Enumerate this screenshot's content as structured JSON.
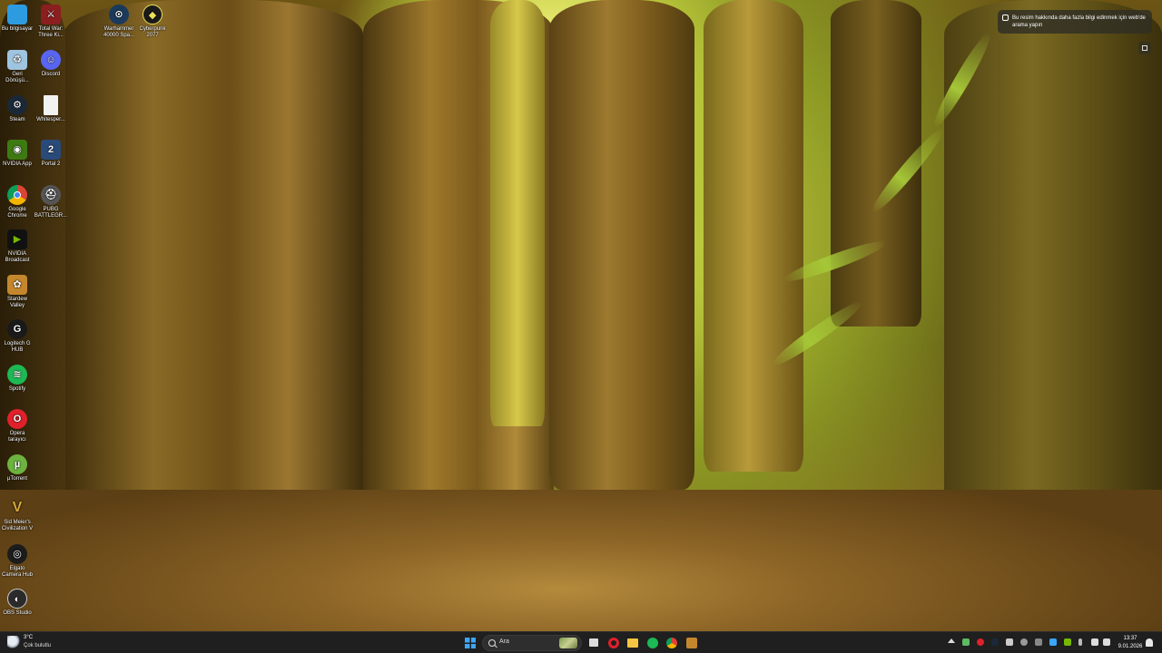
{
  "desktop": {
    "icons_col1": [
      {
        "name": "this-pc-icon",
        "label": "Bu bilgisayar",
        "color": "#2d9be0"
      },
      {
        "name": "recycle-bin-icon",
        "label": "Geri\nDönüşü...",
        "color": "#9fc4e0"
      },
      {
        "name": "steam-icon",
        "label": "Steam",
        "color": "#1b2838"
      },
      {
        "name": "nvidia-app-icon",
        "label": "NVIDIA App",
        "color": "#3d7a12"
      },
      {
        "name": "google-chrome-icon",
        "label": "Google\nChrome",
        "color": "#db4437"
      },
      {
        "name": "nvidia-broadcast-icon",
        "label": "NVIDIA\nBroadcast",
        "color": "#111111"
      },
      {
        "name": "stardew-valley-icon",
        "label": "Stardew\nValley",
        "color": "#c5872d"
      },
      {
        "name": "logitech-ghub-icon",
        "label": "Logitech G\nHUB",
        "color": "#1a1a1a"
      },
      {
        "name": "spotify-icon",
        "label": "Spotify",
        "color": "#1db954"
      },
      {
        "name": "opera-icon",
        "label": "Opera\ntarayıcı",
        "color": "#e0212b"
      },
      {
        "name": "utorrent-icon",
        "label": "µTorrent",
        "color": "#6cb33f"
      },
      {
        "name": "civilization-v-icon",
        "label": "Sid Meier's\nCivilization V",
        "color": "#d9a93a"
      },
      {
        "name": "elgato-camera-hub-icon",
        "label": "Elgato\nCamera Hub",
        "color": "#1c1c1c"
      },
      {
        "name": "obs-studio-icon",
        "label": "OBS Studio",
        "color": "#2b2b2b"
      }
    ],
    "icons_col2": [
      {
        "name": "total-war-icon",
        "label": "Total War:\nThree Ki...",
        "color": "#8b1e1e"
      },
      {
        "name": "discord-icon",
        "label": "Discord",
        "color": "#5865f2"
      },
      {
        "name": "file-icon",
        "label": "Whitesper...",
        "color": "#f2f2f2"
      },
      {
        "name": "pubg-2-icon",
        "label": "Portal 2",
        "color": "#2a4a7a"
      },
      {
        "name": "pubg-icon",
        "label": "PUBG\nBATTLEGR...",
        "color": "#555555"
      }
    ],
    "icons_top": [
      {
        "name": "warhammer-icon",
        "label": "Warhammer\n40000 Spa...",
        "color": "#1b3a5c"
      },
      {
        "name": "cyberpunk-icon",
        "label": "Cyberpunk\n2077",
        "color": "#1a1a1a"
      }
    ]
  },
  "spotlight": {
    "text": "Bu resim hakkında daha fazla bilgi edinmek için web'de arama yapın"
  },
  "taskbar": {
    "weather_temp": "3°C",
    "weather_cond": "Çok bulutlu",
    "search_placeholder": "Ara",
    "clock_time": "13:37",
    "clock_date": "9.01.2026",
    "accent": "#3aa6ff"
  }
}
